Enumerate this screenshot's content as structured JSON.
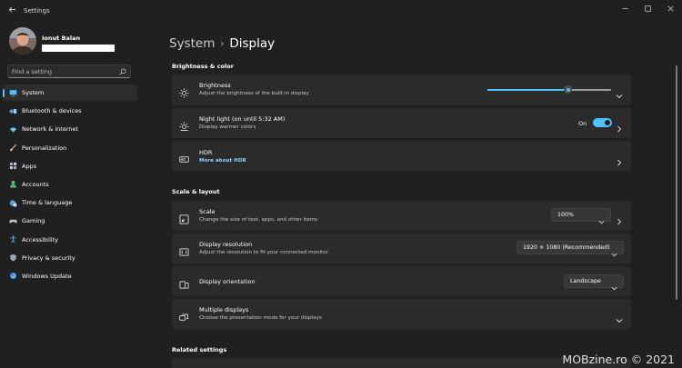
{
  "window": {
    "title": "Settings"
  },
  "profile": {
    "name": "Ionut Balan"
  },
  "search": {
    "placeholder": "Find a setting"
  },
  "sidebar": {
    "items": [
      {
        "label": "System",
        "icon": "monitor-icon",
        "selected": true
      },
      {
        "label": "Bluetooth & devices",
        "icon": "bluetooth-icon"
      },
      {
        "label": "Network & internet",
        "icon": "wifi-icon"
      },
      {
        "label": "Personalization",
        "icon": "brush-icon"
      },
      {
        "label": "Apps",
        "icon": "apps-icon"
      },
      {
        "label": "Accounts",
        "icon": "person-icon"
      },
      {
        "label": "Time & language",
        "icon": "globe-clock-icon"
      },
      {
        "label": "Gaming",
        "icon": "gamepad-icon"
      },
      {
        "label": "Accessibility",
        "icon": "accessibility-icon"
      },
      {
        "label": "Privacy & security",
        "icon": "shield-icon"
      },
      {
        "label": "Windows Update",
        "icon": "update-icon"
      }
    ]
  },
  "breadcrumb": {
    "parent": "System",
    "separator": "›",
    "current": "Display"
  },
  "sections": {
    "brightness_color": "Brightness & color",
    "scale_layout": "Scale & layout",
    "related": "Related settings"
  },
  "brightness": {
    "title": "Brightness",
    "subtitle": "Adjust the brightness of the built-in display",
    "value_fraction": 0.65
  },
  "night_light": {
    "title": "Night light (on until 5:32 AM)",
    "subtitle": "Display warmer colors",
    "state_label": "On",
    "on": true
  },
  "hdr": {
    "title": "HDR",
    "link": "More about HDR"
  },
  "scale": {
    "title": "Scale",
    "subtitle": "Change the size of text, apps, and other items",
    "value": "100%"
  },
  "resolution": {
    "title": "Display resolution",
    "subtitle": "Adjust the resolution to fit your connected monitor",
    "value": "1920 × 1080 (Recommended)"
  },
  "orientation": {
    "title": "Display orientation",
    "value": "Landscape"
  },
  "multiple_displays": {
    "title": "Multiple displays",
    "subtitle": "Choose the presentation mode for your displays"
  },
  "watermark": "MOBzine.ro © 2021",
  "colors": {
    "accent": "#4cc2ff",
    "background": "#202020",
    "card": "#2b2b2b"
  }
}
